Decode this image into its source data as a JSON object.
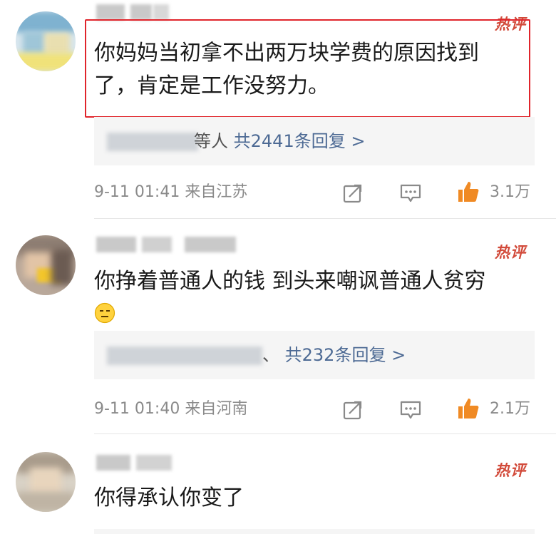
{
  "comments": [
    {
      "hot_label": "热评",
      "text_lines": [
        "你妈妈当初拿不出两万块学费的原因找到",
        "了，肯定是工作没努力。"
      ],
      "reply": {
        "names_suffix": "等人",
        "link": "共2441条回复 >"
      },
      "time": "9-11 01:41",
      "location": "来自江苏",
      "likes": "3.1万"
    },
    {
      "hot_label": "热评",
      "text_lines": [
        "你挣着普通人的钱 到头来嘲讽普通人贫穷"
      ],
      "reply": {
        "names_suffix": "、",
        "link": "共232条回复 >"
      },
      "time": "9-11 01:40",
      "location": "来自河南",
      "likes": "2.1万"
    },
    {
      "hot_label": "热评",
      "text_lines": [
        "你得承认你变了"
      ]
    }
  ],
  "colors": {
    "accent_red": "#d24a3a",
    "highlight_border": "#e0242b",
    "like_orange": "#f08a24",
    "reply_link": "#4d6a94"
  },
  "icons": [
    "share-icon",
    "comment-icon",
    "like-icon",
    "emoji-icon"
  ]
}
